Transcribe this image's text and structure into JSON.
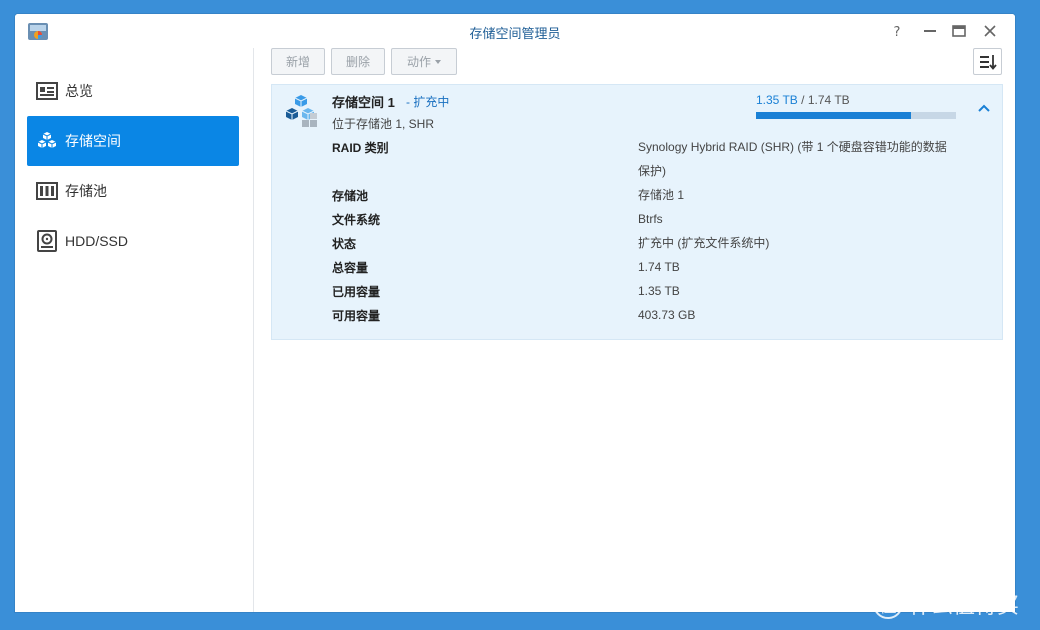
{
  "window": {
    "title": "存储空间管理员",
    "controls": [
      "help-icon",
      "minimize-icon",
      "maximize-icon",
      "close-icon"
    ]
  },
  "sidebar": {
    "items": [
      {
        "label": "总览",
        "icon": "overview-icon",
        "active": false
      },
      {
        "label": "存储空间",
        "icon": "volume-cubes-icon",
        "active": true
      },
      {
        "label": "存储池",
        "icon": "storage-pool-icon",
        "active": false
      },
      {
        "label": "HDD/SSD",
        "icon": "hdd-icon",
        "active": false
      }
    ]
  },
  "toolbar": {
    "create_label": "新增",
    "delete_label": "删除",
    "action_label": "动作"
  },
  "volume": {
    "name": "存储空间 1",
    "status": "- 扩充中",
    "location": "位于存储池 1, SHR",
    "used": "1.35 TB",
    "separator": "/",
    "total": "1.74 TB",
    "usage_fraction": 0.776,
    "details": [
      {
        "key": "RAID 类别",
        "value": "Synology Hybrid RAID (SHR) (带 1 个硬盘容错功能的数据保护)"
      },
      {
        "key": "存储池",
        "value": "存储池 1"
      },
      {
        "key": "文件系统",
        "value": "Btrfs"
      },
      {
        "key": "状态",
        "value": "扩充中 (扩充文件系统中)"
      },
      {
        "key": "总容量",
        "value": "1.74 TB"
      },
      {
        "key": "已用容量",
        "value": "1.35 TB"
      },
      {
        "key": "可用容量",
        "value": "403.73 GB"
      }
    ]
  },
  "watermark": {
    "badge": "值",
    "text": "什么值得买"
  },
  "colors": {
    "accent": "#0a86e5",
    "link": "#1a70c0",
    "panel": "#e7f3fc",
    "desktop": "#3a8fd8"
  }
}
